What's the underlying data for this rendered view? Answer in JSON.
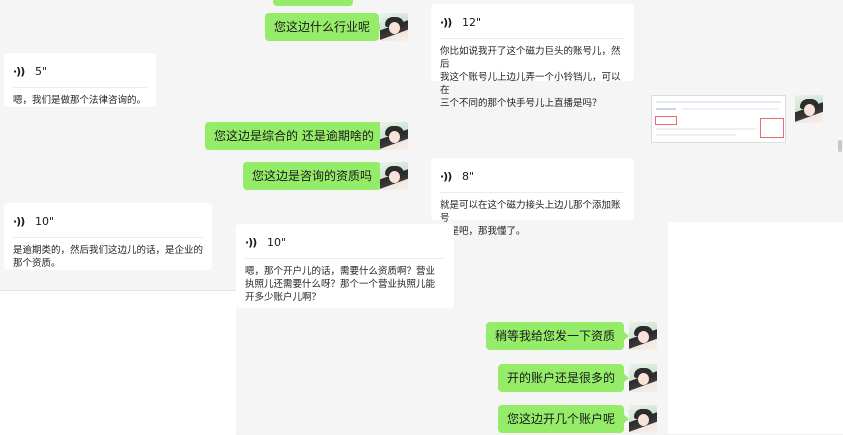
{
  "messages": {
    "sent_industry": "您这边什么行业呢",
    "sent_comprehensive": "您这边是综合的 还是逾期啥的",
    "sent_qualification": "您这边是咨询的资质吗",
    "sent_send_docs": "稍等我给您发一下资质",
    "sent_many_accounts": "开的账户还是很多的",
    "sent_how_many": "您这边开几个账户呢",
    "voice_12": {
      "duration": "12\"",
      "text": "你比如说我开了这个磁力巨头的账号儿，然后\n我这个账号儿上边儿弄一个小铃铛儿，可以在\n三个不同的那个快手号儿上直播是吗？"
    },
    "voice_5": {
      "duration": "5\"",
      "text": "嗯，我们是做那个法律咨询的。"
    },
    "voice_8": {
      "duration": "8\"",
      "text": "就是可以在这个磁力接头上边儿那个添加账号\n儿是吧，那我懂了。"
    },
    "voice_10a": {
      "duration": "10\"",
      "text": "是逾期类的，然后我们这边儿的话，是企业的\n那个资质。"
    },
    "voice_10b": {
      "duration": "10\"",
      "text": "嗯，那个开户儿的话，需要什么资质啊？营业\n执照儿还需要什么呀？那个一个营业执照儿能\n开多少账户儿啊？"
    }
  },
  "icons": {
    "voice": "voice-wave-icon",
    "avatar": "user-avatar-icon"
  },
  "colors": {
    "sent_bubble": "#95ec69",
    "received_bubble": "#ffffff",
    "background": "#f5f5f5"
  }
}
